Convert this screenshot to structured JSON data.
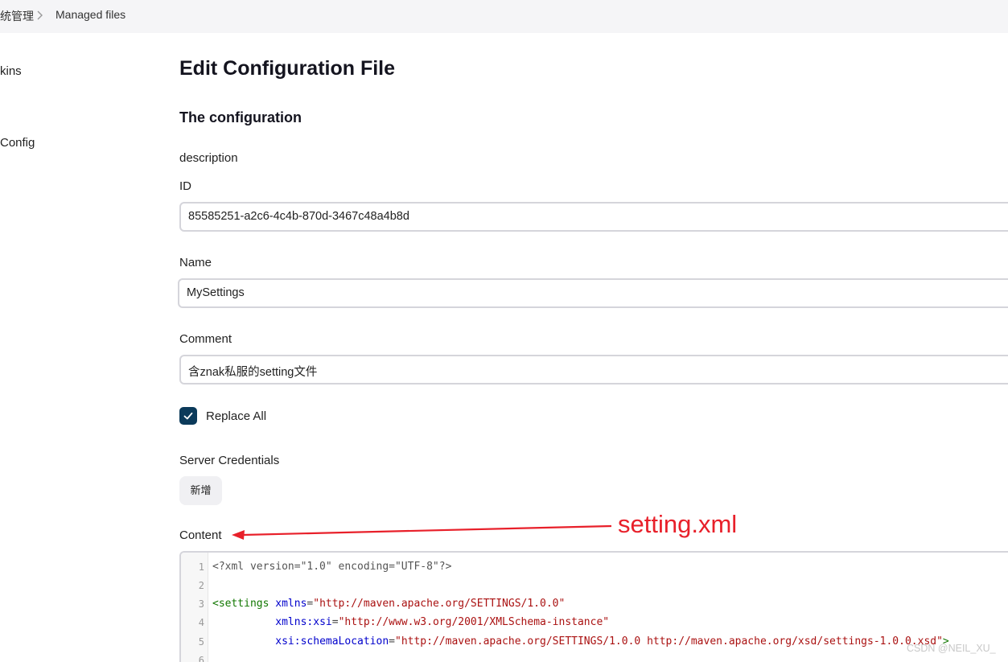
{
  "breadcrumb": {
    "parent": "统管理",
    "current": "Managed files"
  },
  "sidebar": {
    "item_1": "kins",
    "item_2": "Config"
  },
  "page": {
    "title": "Edit Configuration File",
    "section_title": "The configuration",
    "description_label": "description"
  },
  "form": {
    "id_label": "ID",
    "id_value": "85585251-a2c6-4c4b-870d-3467c48a4b8d",
    "name_label": "Name",
    "name_value": "MySettings",
    "comment_label": "Comment",
    "comment_value": "含znak私服的setting文件",
    "replace_all_label": "Replace All",
    "replace_all_checked": true,
    "server_credentials_label": "Server Credentials",
    "add_button_label": "新增",
    "content_label": "Content"
  },
  "annotation": {
    "text": "setting.xml",
    "color": "#e8202a"
  },
  "editor": {
    "line_numbers": [
      "1",
      "2",
      "3",
      "4",
      "5",
      "6"
    ],
    "lines": [
      "<?xml version=\"1.0\" encoding=\"UTF-8\"?>",
      "",
      "<settings xmlns=\"http://maven.apache.org/SETTINGS/1.0.0\"",
      "          xmlns:xsi=\"http://www.w3.org/2001/XMLSchema-instance\"",
      "          xsi:schemaLocation=\"http://maven.apache.org/SETTINGS/1.0.0 http://maven.apache.org/xsd/settings-1.0.0.xsd\">",
      ""
    ]
  },
  "watermark": "CSDN @NEIL_XU_",
  "colors": {
    "checkbox": "#0b3a5a",
    "xml_tag": "#117700",
    "xml_attr": "#0000cc",
    "xml_string": "#aa1111"
  }
}
